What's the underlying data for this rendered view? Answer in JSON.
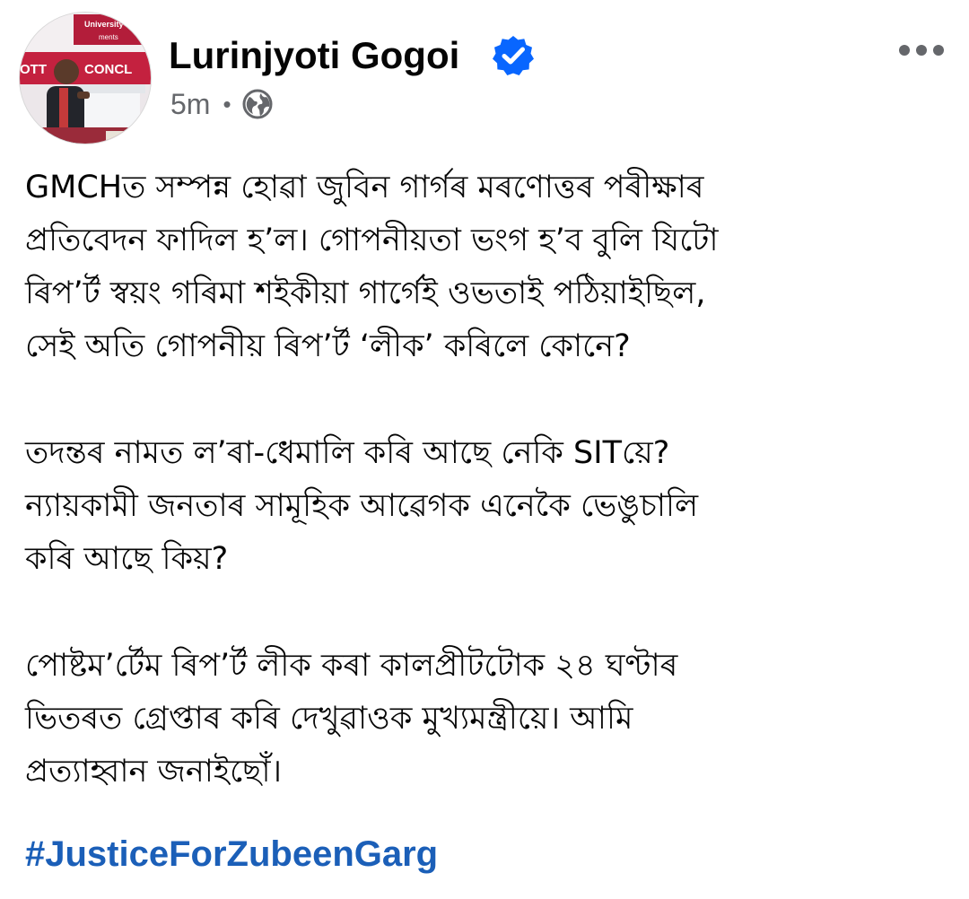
{
  "post": {
    "author": {
      "name": "Lurinjyoti Gogoi",
      "verified": true,
      "avatar_icon": "profile-photo-speaker-at-podium",
      "avatar_banner_texts": [
        "University Studen",
        "ments",
        "OTT",
        "CONCL"
      ]
    },
    "meta": {
      "time": "5m",
      "separator": "•",
      "audience_icon": "globe-icon"
    },
    "more_icon": "more-options-icon",
    "body": {
      "paragraphs": [
        [
          "GMCHত সম্পন্ন হোৱা জুবিন গাৰ্গৰ মৰণোত্তৰ পৰীক্ষাৰ",
          "প্ৰতিবেদন ফাদিল হ’ল। গোপনীয়তা ভংগ হ’ব বুলি যিটো",
          "ৰিপ’ৰ্ট স্বয়ং গৰিমা শইকীয়া গাৰ্গেই ওভতাই পঠিয়াইছিল,",
          "সেই অতি গোপনীয় ৰিপ’ৰ্ট ‘লীক’ কৰিলে কোনে?"
        ],
        [
          "তদন্তৰ নামত ল’ৰা-ধেমালি কৰি আছে নেকি SITয়ে?",
          "ন্যায়কামী জনতাৰ সামূহিক আৱেগক এনেকৈ ভেঙুচালি",
          "কৰি আছে কিয়?"
        ],
        [
          "পোষ্টম’ৰ্টেম ৰিপ’ৰ্ট লীক কৰা কালপ্ৰীটটোক ২৪ ঘণ্টাৰ",
          "ভিতৰত গ্ৰেপ্তাৰ কৰি দেখুৱাওক মুখ্যমন্ত্ৰীয়ে। আমি",
          "প্ৰত্যাহ্বান জনাইছোঁ।"
        ]
      ]
    },
    "hashtag": "#JusticeForZubeenGarg"
  },
  "colors": {
    "text": "#050505",
    "meta": "#65676b",
    "link": "#1b5fb8",
    "verified_badge": "#0866ff"
  }
}
